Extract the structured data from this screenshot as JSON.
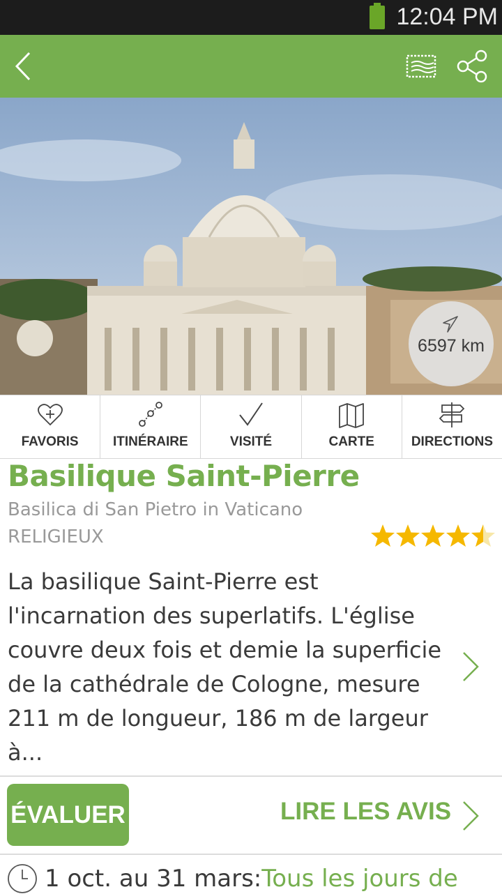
{
  "status_bar": {
    "time": "12:04 PM"
  },
  "colors": {
    "accent": "#76af4f",
    "status_bar": "#1c1c1c",
    "star": "#f5b800"
  },
  "app_bar": {
    "icons": [
      "back-arrow-icon",
      "postcard-stamp-icon",
      "share-icon"
    ]
  },
  "hero": {
    "distance": "6597 km"
  },
  "actions": [
    {
      "label": "FAVORIS",
      "icon": "heart-plus-icon"
    },
    {
      "label": "ITINÉRAIRE",
      "icon": "route-icon"
    },
    {
      "label": "VISITÉ",
      "icon": "checkmark-icon"
    },
    {
      "label": "CARTE",
      "icon": "map-icon"
    },
    {
      "label": "DIRECTIONS",
      "icon": "signpost-icon"
    }
  ],
  "place": {
    "title": "Basilique Saint-Pierre",
    "subtitle": "Basilica di San Pietro in Vaticano",
    "category": "RELIGIEUX",
    "rating": 4.5,
    "rating_max": 5,
    "description": "La basilique Saint-Pierre est l'incarnation des superlatifs. L'église couvre deux fois et demie la superficie de la cathédrale de Cologne, mesure 211 m de longueur, 186 m de largeur à..."
  },
  "reviews": {
    "rate_label": "ÉVALUER",
    "read_label": "LIRE LES AVIS"
  },
  "hours": {
    "period": "1 oct. au 31 mars:",
    "days": "Tous les jours de"
  }
}
